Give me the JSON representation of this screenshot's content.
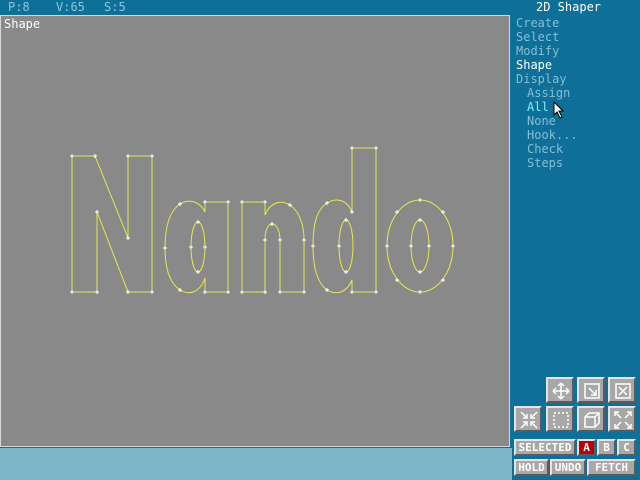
{
  "status": {
    "points": "P:8",
    "vertices": "V:65",
    "shapes": "S:5"
  },
  "viewport": {
    "title": "Shape"
  },
  "app": {
    "title": "2D Shaper"
  },
  "menu": {
    "main": [
      "Create",
      "Select",
      "Modify",
      "Shape",
      "Display"
    ],
    "sub": [
      "Assign",
      "All",
      "None",
      "Hook...",
      "Check",
      "Steps"
    ]
  },
  "tools": {
    "row1": [
      "move-icon",
      "scale-corner-icon",
      "close-x-icon"
    ],
    "row2": [
      "shrink-icon",
      "region-select-icon",
      "cube-icon",
      "expand-icon"
    ]
  },
  "buttons": {
    "selected": "SELECTED",
    "a": "A",
    "b": "B",
    "c": "C",
    "hold": "HOLD",
    "undo": "UNDO",
    "fetch": "FETCH"
  },
  "colors": {
    "background": "#0e6f98",
    "viewport": "#898989",
    "shape_line": "#e8e84a",
    "vertex": "#ffffff",
    "selected": "#c00000"
  }
}
